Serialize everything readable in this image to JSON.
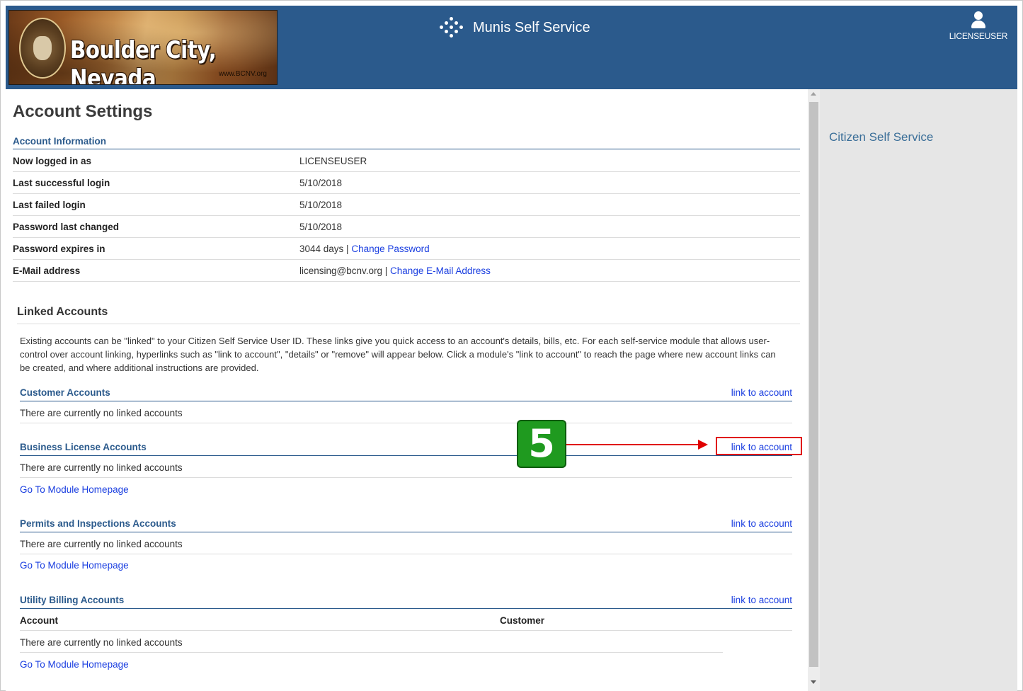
{
  "header": {
    "logo_title": "Boulder City, Nevada",
    "logo_url": "www.BCNV.org",
    "brand_title": "Munis Self Service",
    "user_name": "LICENSEUSER",
    "colors": {
      "bar": "#2b5a8c"
    }
  },
  "page": {
    "title": "Account Settings"
  },
  "account_info": {
    "heading": "Account Information",
    "rows": [
      {
        "label": "Now logged in as",
        "value": "LICENSEUSER"
      },
      {
        "label": "Last successful login",
        "value": "5/10/2018"
      },
      {
        "label": "Last failed login",
        "value": "5/10/2018"
      },
      {
        "label": "Password last changed",
        "value": "5/10/2018"
      },
      {
        "label": "Password expires in",
        "value": "3044 days |",
        "link": "Change Password"
      },
      {
        "label": "E-Mail address",
        "value": "licensing@bcnv.org |",
        "link": "Change E-Mail Address"
      }
    ]
  },
  "linked": {
    "title": "Linked Accounts",
    "description": "Existing accounts can be \"linked\" to your Citizen Self Service User ID. These links give you quick access to an account's details, bills, etc. For each self-service module that allows user-control over account linking, hyperlinks such as \"link to account\", \"details\" or \"remove\" will appear below. Click a module's \"link to account\" to reach the page where new account links can be created, and where additional instructions are provided.",
    "modules": [
      {
        "title": "Customer Accounts",
        "link": "link to account",
        "empty": "There are currently no linked accounts"
      },
      {
        "title": "Business License Accounts",
        "link": "link to account",
        "empty": "There are currently no linked accounts",
        "home": "Go To Module Homepage"
      },
      {
        "title": "Permits and Inspections Accounts",
        "link": "link to account",
        "empty": "There are currently no linked accounts",
        "home": "Go To Module Homepage"
      },
      {
        "title": "Utility Billing Accounts",
        "link": "link to account",
        "columns": [
          "Account",
          "Customer"
        ],
        "empty": "There are currently no linked accounts",
        "home": "Go To Module Homepage"
      }
    ]
  },
  "annotation": {
    "step_number": "5",
    "colors": {
      "badge": "#1f9a1f",
      "arrow": "#e00000"
    }
  },
  "sidebar": {
    "link": "Citizen Self Service"
  }
}
